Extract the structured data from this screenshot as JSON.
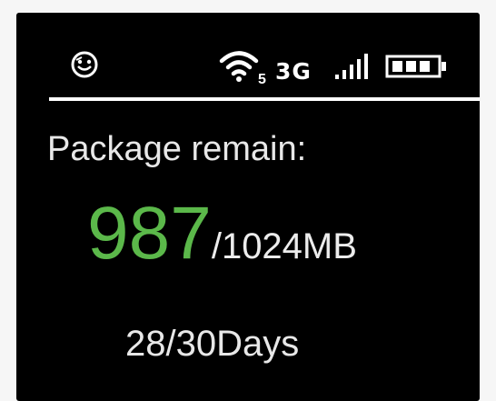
{
  "status_bar": {
    "icons": [
      "smiley-icon",
      "wifi-icon",
      "signal-icon",
      "battery-icon"
    ],
    "wifi_clients": "5",
    "network_type": "3G"
  },
  "package": {
    "label": "Package remain:",
    "remaining": "987",
    "total": "/1024MB",
    "days": "28/30Days"
  },
  "colors": {
    "background": "#000000",
    "text": "#ffffff",
    "accent": "#5bb84a"
  }
}
